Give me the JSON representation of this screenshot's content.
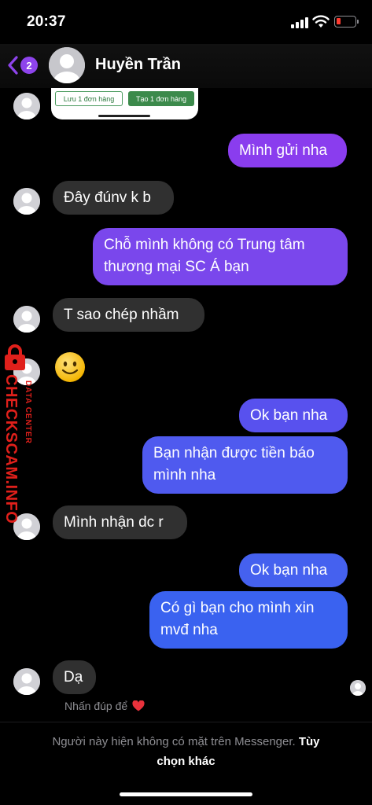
{
  "status_bar": {
    "time": "20:37",
    "battery_color": "#ff3b30"
  },
  "header": {
    "back_badge": "2",
    "contact_name": "Huyền Trần"
  },
  "thumbnail": {
    "btn_left": "Lưu 1 đơn hàng",
    "btn_right": "Tạo 1 đơn hàng"
  },
  "messages": [
    {
      "side": "out",
      "text": "Mình gửi nha"
    },
    {
      "side": "in",
      "text": "Đây đúnv k b"
    },
    {
      "side": "out",
      "lines": [
        "Chỗ mình không có Trung tâm",
        "thương mại SC Á bạn"
      ]
    },
    {
      "side": "in",
      "text": "T sao chép nhầm"
    },
    {
      "side": "in",
      "emoji": "slightly-smiling-face"
    },
    {
      "side": "out",
      "text": "Ok bạn nha"
    },
    {
      "side": "out",
      "lines": [
        "Bạn nhận được tiền báo",
        "mình nha"
      ]
    },
    {
      "side": "in",
      "text": "Mình nhận dc r"
    },
    {
      "side": "out",
      "text": "Ok bạn nha"
    },
    {
      "side": "out",
      "lines": [
        "Có gì bạn cho mình xin",
        "mvđ nha"
      ]
    },
    {
      "side": "in",
      "text": "Dạ"
    }
  ],
  "reaction_hint": {
    "text": "Nhấn đúp để",
    "icon": "heart-icon"
  },
  "watermark": {
    "main": "CHECKSCAM.INFO",
    "sub": "DATA CENTER"
  },
  "footer": {
    "notice": "Người này hiện không có mặt trên Messenger.",
    "link_1": "Tùy",
    "link_2": "chọn khác"
  },
  "colors": {
    "bubble_in": "#303030",
    "bubble_out_purple": "#8a3dee",
    "bubble_out_blue": "#3a5ef0",
    "accent": "#8e44ec"
  }
}
